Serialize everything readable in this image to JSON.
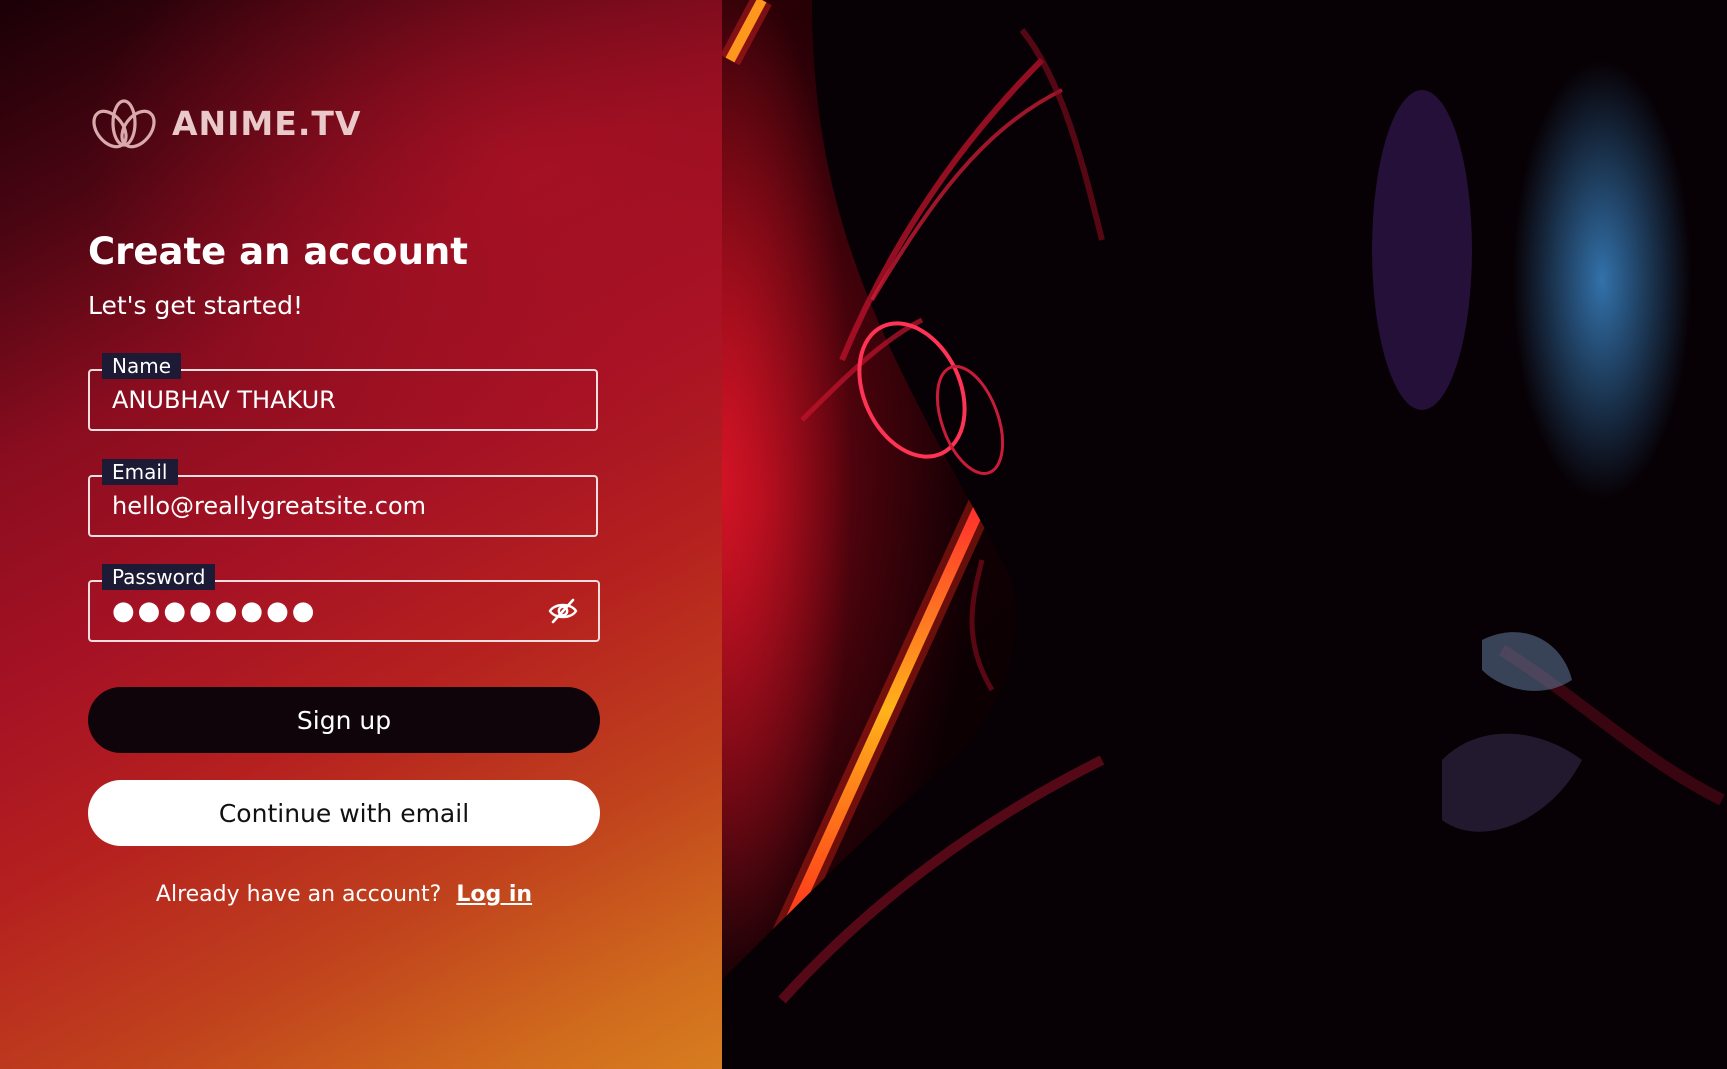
{
  "brand": {
    "name": "ANIME.TV",
    "logo_icon": "lotus-icon"
  },
  "heading": {
    "title": "Create an account",
    "subtitle": "Let's get started!"
  },
  "form": {
    "name": {
      "label": "Name",
      "value": "ANUBHAV THAKUR"
    },
    "email": {
      "label": "Email",
      "value": "hello@reallygreatsite.com"
    },
    "password": {
      "label": "Password",
      "masked_value": "●●●●●●●●",
      "toggle_icon": "eye-off-icon"
    }
  },
  "buttons": {
    "signup_label": "Sign up",
    "continue_email_label": "Continue with email"
  },
  "footer": {
    "prompt": "Already have an account?",
    "login_label": "Log in"
  },
  "hero_image": {
    "description_icon": "anime-character-photo"
  },
  "colors": {
    "signup_button": "#0f040a",
    "email_button": "#ffffff",
    "label_background": "#1c1a34",
    "gradient_start": "#1a0006",
    "gradient_mid": "#a51224",
    "gradient_end": "#d77d20",
    "logo_text": "#e9c9c9"
  }
}
